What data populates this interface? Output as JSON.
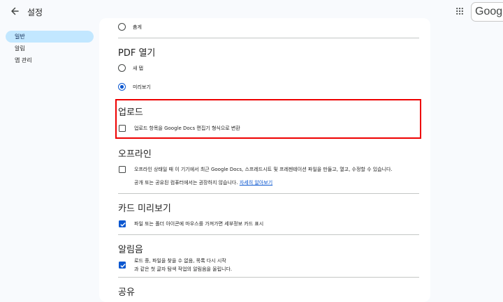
{
  "header": {
    "title": "설정",
    "logo_text": "Google"
  },
  "nav": {
    "items": [
      {
        "label": "일반",
        "active": true
      },
      {
        "label": "알림",
        "active": false
      },
      {
        "label": "앱 관리",
        "active": false
      }
    ]
  },
  "density": {
    "option_label": "촘게"
  },
  "pdf": {
    "heading": "PDF 열기",
    "option_new_tab": "새 탭",
    "option_preview": "미리보기",
    "selected": "미리보기"
  },
  "upload": {
    "heading": "업로드",
    "convert_label": "업로드 항목을 Google Docs 편집기 형식으로 변환",
    "checked": false
  },
  "offline": {
    "heading": "오프라인",
    "label": "오프라인 상태일 때 이 기기에서 최근 Google Docs, 스프레드시트 및 프레젠테이션 파일을 만들고, 열고, 수정할 수 있습니다.",
    "note": "공개 또는 공유된 컴퓨터에서는 권장하지 않습니다.",
    "link": "자세히 알아보기",
    "checked": false
  },
  "card_preview": {
    "heading": "카드 미리보기",
    "label": "파일 또는 폴더 아이콘에 마우스를 가져가면 세부정보 카드 표시",
    "checked": true
  },
  "notification_sound": {
    "heading": "알림음",
    "label_line1": "로드 중, 파일을 찾을 수 없음, 목록 다시 시작",
    "label_line2": "과 같은 첫 글자 탐색 작업의 알림음을 울립니다.",
    "checked": true
  },
  "sharing": {
    "heading": "공유"
  },
  "colors": {
    "accent": "#0b57d0",
    "nav_active_bg": "#c2e7ff",
    "highlight_border": "#ee0000"
  }
}
